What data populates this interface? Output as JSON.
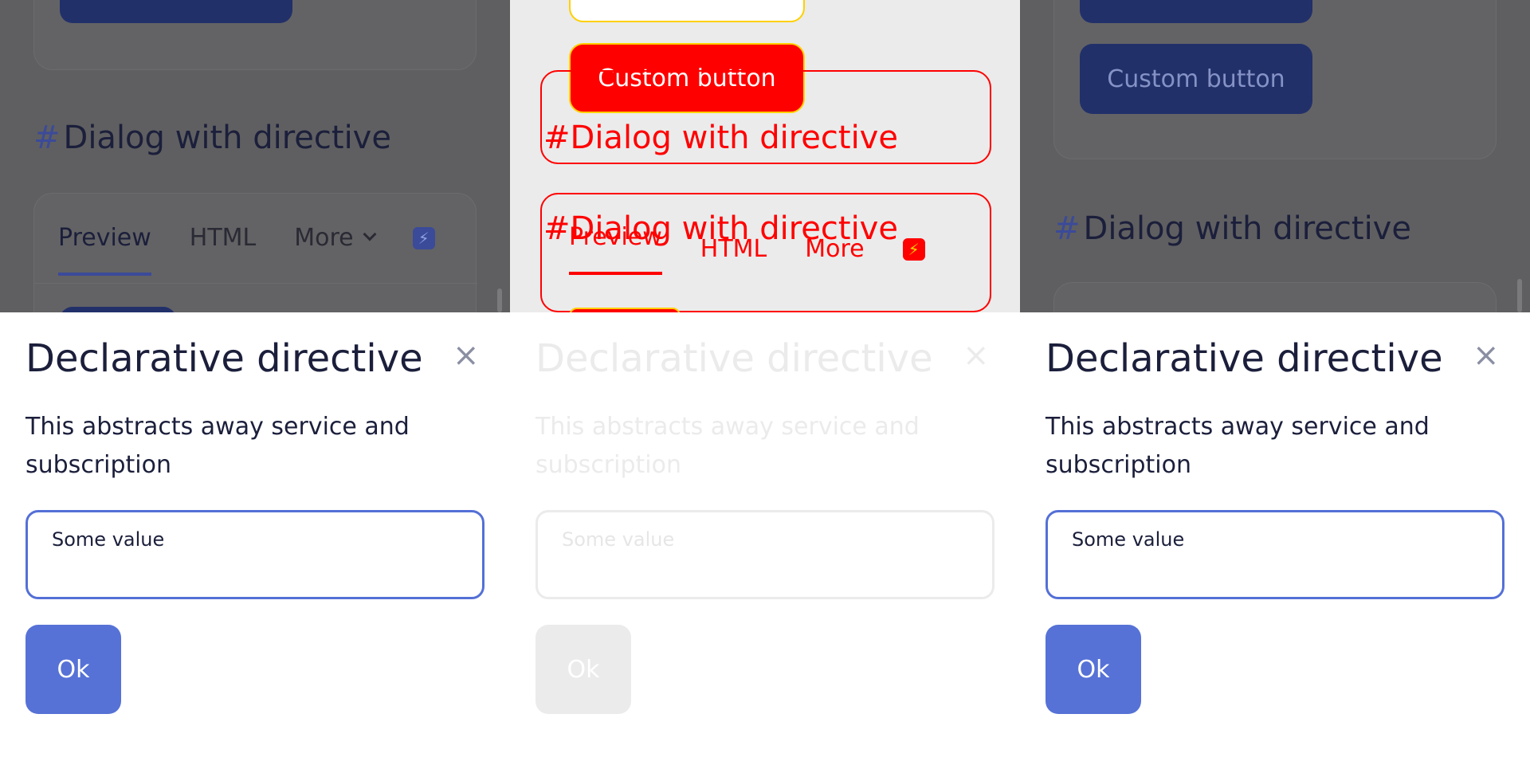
{
  "background": {
    "custom_button_label": "Custom button",
    "section_heading": "Dialog with directive",
    "hash": "#",
    "tabs": [
      "Preview",
      "HTML",
      "More"
    ],
    "bolt_icon": "⚡"
  },
  "dialog": {
    "title": "Declarative directive",
    "close_icon": "×",
    "text": "This abstracts away service and subscription",
    "input_value": "Some value",
    "ok_label": "Ok"
  },
  "colors": {
    "accent": "#5672d6",
    "overlay": "#5f5f61",
    "highlight": "#ff0000"
  }
}
